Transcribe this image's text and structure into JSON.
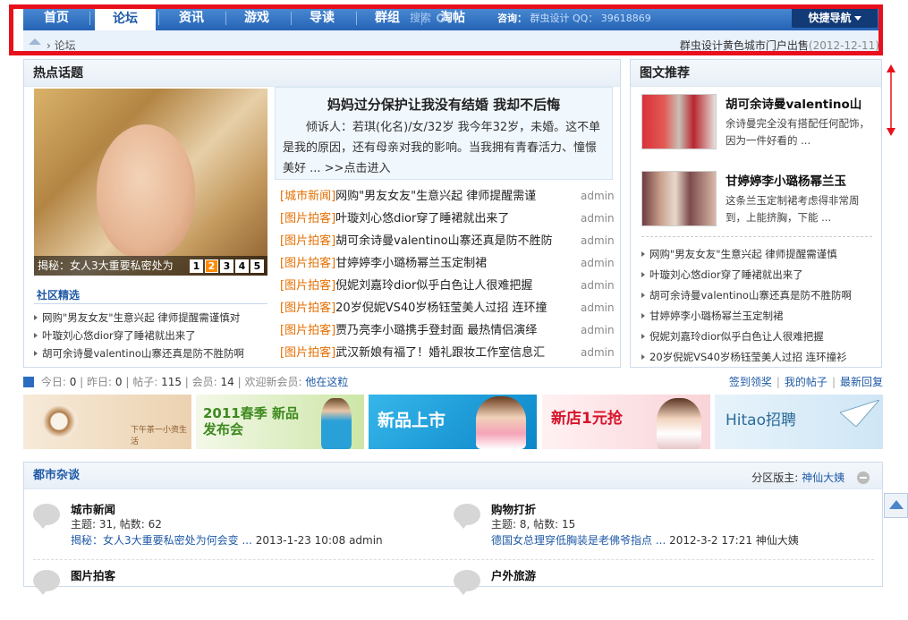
{
  "nav": {
    "items": [
      {
        "label": "首页",
        "active": false
      },
      {
        "label": "论坛",
        "active": true
      },
      {
        "label": "资讯",
        "active": false
      },
      {
        "label": "游戏",
        "active": false
      },
      {
        "label": "导读",
        "active": false
      },
      {
        "label": "群组",
        "active": false
      },
      {
        "label": "淘帖",
        "active": false
      }
    ],
    "search_hint": "搜索",
    "contact_label": "咨询：",
    "contact_text": "群虫设计  QQ：  39618869",
    "quick_nav": "快捷导航"
  },
  "breadcrumb": {
    "current": "论坛",
    "notice": "群虫设计黄色城市门户出售",
    "notice_date": "(2012-12-11)"
  },
  "hot": {
    "title": "热点话题",
    "image_caption": "揭秘：女人3大重要私密处为",
    "pager": [
      "1",
      "2",
      "3",
      "4",
      "5"
    ],
    "community_title": "社区精选",
    "community": [
      "网购\"男友女友\"生意兴起 律师提醒需谨慎对",
      "叶璇刘心悠dior穿了睡裙就出来了",
      "胡可余诗曼valentino山寨还真是防不胜防啊"
    ],
    "featured_title": "妈妈过分保护让我没有结婚 我却不后悔",
    "featured_body": "倾诉人：若琪(化名)/女/32岁 我今年32岁，未婚。这不单是我的原因，还有母亲对我的影响。当我拥有青春活力、憧憬美好 ... >>点击进入",
    "items": [
      {
        "tag": "[城市新闻]",
        "title": "网购\"男友女友\"生意兴起 律师提醒需谨",
        "author": "admin"
      },
      {
        "tag": "[图片拍客]",
        "title": "叶璇刘心悠dior穿了睡裙就出来了",
        "author": "admin"
      },
      {
        "tag": "[图片拍客]",
        "title": "胡可余诗曼valentino山寨还真是防不胜防",
        "author": "admin"
      },
      {
        "tag": "[图片拍客]",
        "title": "甘婷婷李小璐杨幂兰玉定制裙",
        "author": "admin"
      },
      {
        "tag": "[图片拍客]",
        "title": "倪妮刘嘉玲dior似乎白色让人很难把握",
        "author": "admin"
      },
      {
        "tag": "[图片拍客]",
        "title": "20岁倪妮VS40岁杨钰莹美人过招 连环撞",
        "author": "admin"
      },
      {
        "tag": "[图片拍客]",
        "title": "贾乃亮李小璐携手登封面 最热情侣演绎",
        "author": "admin"
      },
      {
        "tag": "[图片拍客]",
        "title": "武汉新娘有福了！婚礼跟妆工作室信息汇",
        "author": "admin"
      }
    ]
  },
  "picrec": {
    "title": "图文推荐",
    "items": [
      {
        "title": "胡可余诗曼valentino山",
        "desc": "余诗曼完全没有搭配任何配饰，因为一件好看的 ..."
      },
      {
        "title": "甘婷婷李小璐杨幂兰玉",
        "desc": "这条兰玉定制裙考虑得非常周到，上能挤胸，下能 ..."
      }
    ],
    "list": [
      "网购\"男友女友\"生意兴起 律师提醒需谨慎",
      "叶璇刘心悠dior穿了睡裙就出来了",
      "胡可余诗曼valentino山寨还真是防不胜防啊",
      "甘婷婷李小璐杨幂兰玉定制裙",
      "倪妮刘嘉玲dior似乎白色让人很难把握",
      "20岁倪妮VS40岁杨钰莹美人过招 连环撞衫"
    ]
  },
  "stats": {
    "today_label": "今日:",
    "today": "0",
    "yesterday_label": "昨日:",
    "yesterday": "0",
    "posts_label": "帖子:",
    "posts": "115",
    "members_label": "会员:",
    "members": "14",
    "welcome_label": "欢迎新会员:",
    "newest": "他在这粒",
    "links": [
      "签到领奖",
      "我的帖子",
      "最新回复"
    ]
  },
  "banners": [
    {
      "text": "下午茶一小资生活",
      "bg": "#f2e4cf"
    },
    {
      "text": "2011春季 新品发布会",
      "bg": "#e6f2d2"
    },
    {
      "text": "新品上市",
      "bg": "#1fa0dc"
    },
    {
      "text": "新店1元抢",
      "bg": "#fde6e8"
    },
    {
      "text": "Hitao招聘",
      "bg": "#eaf4fb"
    }
  ],
  "dushi": {
    "title": "都市杂谈",
    "moderator_label": "分区版主:",
    "moderator": "神仙大姨",
    "forums": [
      {
        "name": "城市新闻",
        "count": "主题: 31, 帖数: 62",
        "last_prefix": "揭秘：",
        "last_title": "女人3大重要私密处为何会变 ...",
        "last_meta": "2013-1-23 10:08 admin"
      },
      {
        "name": "购物打折",
        "count": "主题: 8, 帖数: 15",
        "last_prefix": "",
        "last_title": "德国女总理穿低胸装是老佛爷指点 ...",
        "last_meta": "2012-3-2 17:21 神仙大姨"
      },
      {
        "name": "图片拍客",
        "count": "",
        "last_prefix": "",
        "last_title": "",
        "last_meta": ""
      },
      {
        "name": "户外旅游",
        "count": "",
        "last_prefix": "",
        "last_title": "",
        "last_meta": ""
      }
    ]
  },
  "colors": {
    "nav": "#2b6cc0",
    "accent_orange": "#e66f00",
    "link_blue": "#1f5aa6",
    "annotation_red": "#e8101c"
  }
}
